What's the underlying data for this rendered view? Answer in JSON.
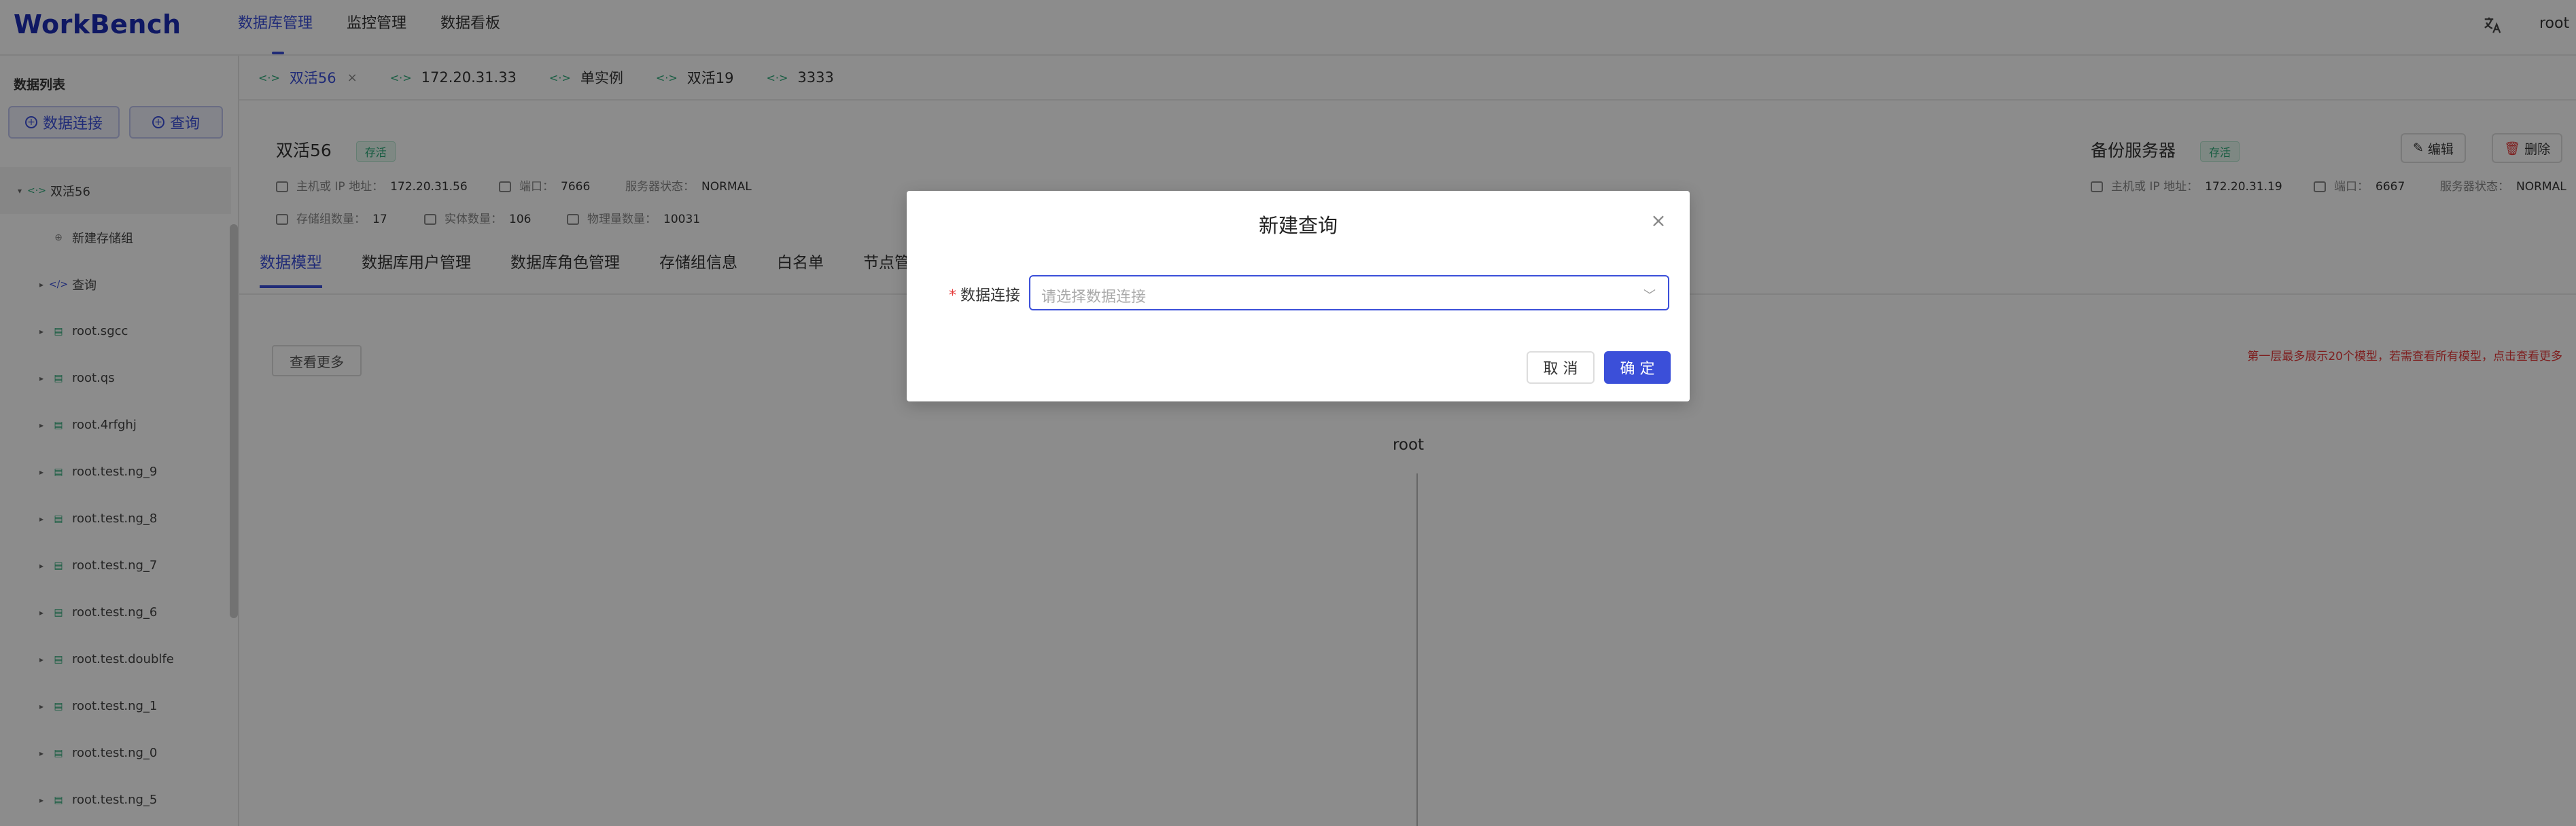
{
  "app": {
    "logo": "WorkBench"
  },
  "nav": [
    {
      "label": "数据库管理",
      "active": true
    },
    {
      "label": "监控管理",
      "active": false
    },
    {
      "label": "数据看板",
      "active": false
    }
  ],
  "header": {
    "user": "root ∨"
  },
  "sidebar": {
    "title": "数据列表",
    "connect_label": "数据连接",
    "query_label": "查询",
    "tree": [
      {
        "label": "双活56",
        "caret": "▾",
        "icon": "connection-icon",
        "indent": 0,
        "selected": true
      },
      {
        "label": "新建存储组",
        "caret": "",
        "icon": "add-icon",
        "indent": 1
      },
      {
        "label": "查询",
        "caret": "▸",
        "icon": "code-icon",
        "indent": 1
      },
      {
        "label": "root.sgcc",
        "caret": "▸",
        "icon": "database-icon",
        "indent": 1
      },
      {
        "label": "root.qs",
        "caret": "▸",
        "icon": "database-icon",
        "indent": 1
      },
      {
        "label": "root.4rfghj",
        "caret": "▸",
        "icon": "database-icon",
        "indent": 1
      },
      {
        "label": "root.test.ng_9",
        "caret": "▸",
        "icon": "database-icon",
        "indent": 1
      },
      {
        "label": "root.test.ng_8",
        "caret": "▸",
        "icon": "database-icon",
        "indent": 1
      },
      {
        "label": "root.test.ng_7",
        "caret": "▸",
        "icon": "database-icon",
        "indent": 1
      },
      {
        "label": "root.test.ng_6",
        "caret": "▸",
        "icon": "database-icon",
        "indent": 1
      },
      {
        "label": "root.test.doublfe",
        "caret": "▸",
        "icon": "database-icon",
        "indent": 1
      },
      {
        "label": "root.test.ng_1",
        "caret": "▸",
        "icon": "database-icon",
        "indent": 1
      },
      {
        "label": "root.test.ng_0",
        "caret": "▸",
        "icon": "database-icon",
        "indent": 1
      },
      {
        "label": "root.test.ng_5",
        "caret": "▸",
        "icon": "database-icon",
        "indent": 1
      }
    ]
  },
  "tabs": [
    {
      "label": "双活56",
      "active": true,
      "closable": true
    },
    {
      "label": "172.20.31.33",
      "active": false
    },
    {
      "label": "单实例",
      "active": false
    },
    {
      "label": "双活19",
      "active": false
    },
    {
      "label": "3333",
      "active": false
    }
  ],
  "primary": {
    "title": "双活56",
    "badge": "存活",
    "ip_label": "主机或 IP 地址：",
    "ip": "172.20.31.56",
    "port_label": "端口：",
    "port": "7666",
    "status_label": "服务器状态：",
    "status": "NORMAL",
    "sg_label": "存储组数量：",
    "sg": "17",
    "entity_label": "实体数量：",
    "entity": "106",
    "physical_label": "物理量数量：",
    "physical": "10031"
  },
  "backup": {
    "title": "备份服务器",
    "badge": "存活",
    "ip_label": "主机或 IP 地址：",
    "ip": "172.20.31.19",
    "port_label": "端口：",
    "port": "6667",
    "status_label": "服务器状态：",
    "status": "NORMAL",
    "edit_label": "编辑",
    "delete_label": "删除"
  },
  "subtabs": [
    {
      "label": "数据模型",
      "active": true
    },
    {
      "label": "数据库用户管理"
    },
    {
      "label": "数据库角色管理"
    },
    {
      "label": "存储组信息"
    },
    {
      "label": "白名单"
    },
    {
      "label": "节点管理"
    }
  ],
  "content": {
    "more_label": "查看更多",
    "warning": "第一层最多展示20个模型，若需查看所有模型，点击查看更多",
    "root_label": "root"
  },
  "modal": {
    "title": "新建查询",
    "field_label": "数据连接",
    "required_mark": "*",
    "placeholder": "请选择数据连接",
    "cancel_label": "取 消",
    "ok_label": "确 定"
  },
  "colors": {
    "accent": "#3b4fd9",
    "success": "#2aa877",
    "danger": "#e53a3a"
  }
}
